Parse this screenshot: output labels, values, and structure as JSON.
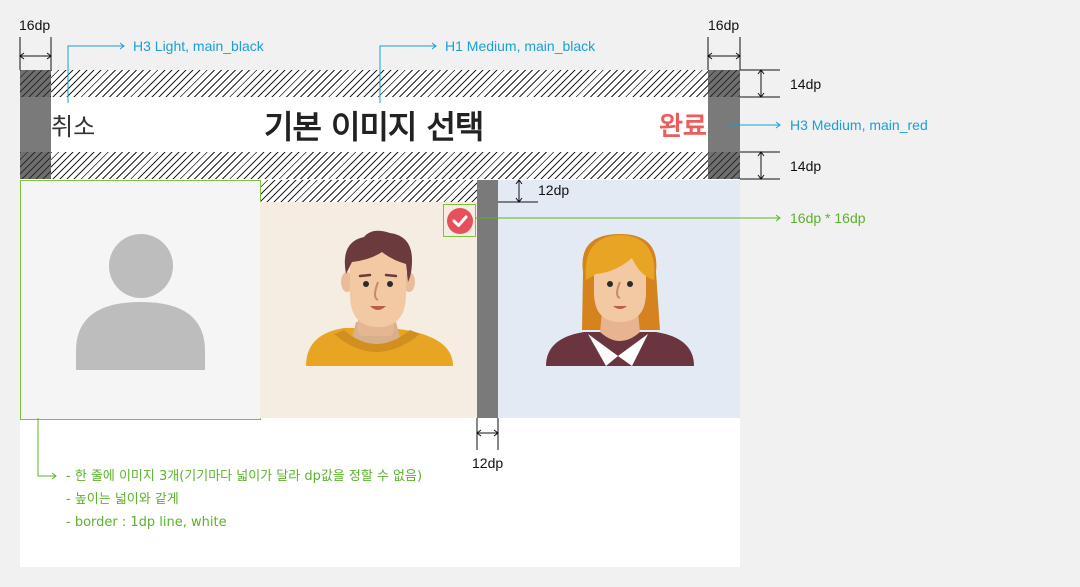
{
  "colors": {
    "background": "#f1f1f1",
    "canvas": "#ffffff",
    "main_red": "#ee5b5b",
    "annotation_blue": "#1b9fd6",
    "annotation_green": "#5ab32a",
    "spacer_gray": "#7a7a7a",
    "default_tile": "#f5f5f5",
    "male_tile": "#f5ede2",
    "female_tile": "#e4eaf4"
  },
  "dimensions": {
    "left_margin": "16dp",
    "right_margin": "16dp",
    "top_padding": "14dp",
    "bottom_padding": "14dp",
    "grid_top": "12dp",
    "check_size": "16dp * 16dp",
    "gutter": "12dp"
  },
  "annotations": {
    "cancel_style": "H3 Light, main_black",
    "title_style": "H1 Medium, main_black",
    "done_style": "H3 Medium, main_red"
  },
  "header": {
    "cancel_label": "취소",
    "title": "기본 이미지 선택",
    "done_label": "완료"
  },
  "images": [
    {
      "name": "default-avatar",
      "icon": "person-silhouette-icon"
    },
    {
      "name": "male-avatar",
      "icon": "male-avatar-icon",
      "selected": true
    },
    {
      "name": "female-avatar",
      "icon": "female-avatar-icon"
    }
  ],
  "notes": [
    "- 한 줄에 이미지 3개(기기마다 넓이가 달라 dp값을 정할 수 없음)",
    "- 높이는 넓이와 같게",
    "- border : 1dp line, white"
  ]
}
